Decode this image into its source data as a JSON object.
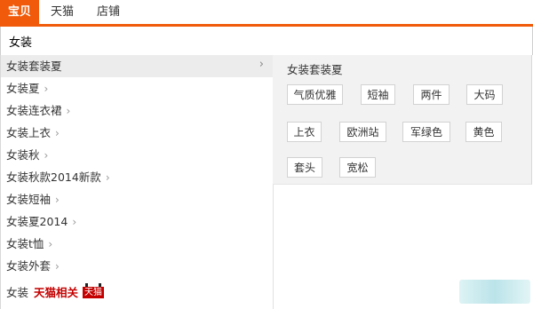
{
  "tabs": [
    {
      "label": "宝贝",
      "active": true
    },
    {
      "label": "天猫",
      "active": false
    },
    {
      "label": "店铺",
      "active": false
    }
  ],
  "search": {
    "value": "女装"
  },
  "suggestions": [
    {
      "label": "女装套装夏",
      "selected": true
    },
    {
      "label": "女装夏"
    },
    {
      "label": "女装连衣裙"
    },
    {
      "label": "女装上衣"
    },
    {
      "label": "女装秋"
    },
    {
      "label": "女装秋款2014新款"
    },
    {
      "label": "女装短袖"
    },
    {
      "label": "女装夏2014"
    },
    {
      "label": "女装t恤"
    },
    {
      "label": "女装外套"
    }
  ],
  "tmall_row": {
    "prefix": "女装",
    "highlight": "天猫相关",
    "badge": "天猫"
  },
  "panel": {
    "title": "女装套装夏",
    "tags": [
      "气质优雅",
      "短袖",
      "两件",
      "大码",
      "上衣",
      "欧洲站",
      "军绿色",
      "黄色",
      "套头",
      "宽松"
    ]
  },
  "colors": {
    "accent": "#f05a0a",
    "tmall": "#c40000"
  }
}
